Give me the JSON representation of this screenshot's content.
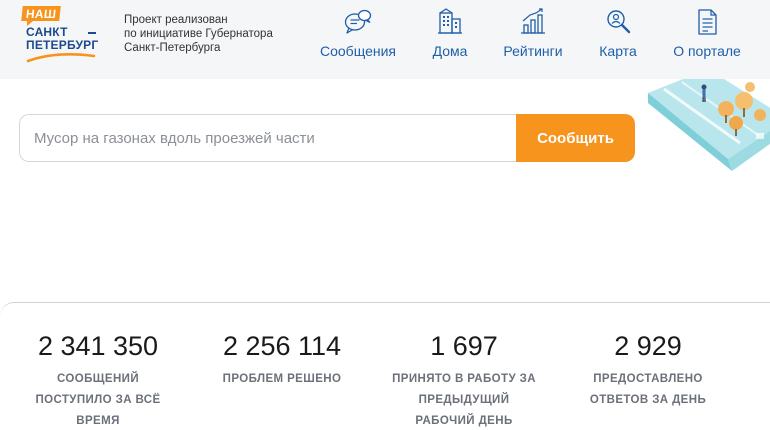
{
  "header": {
    "logo": {
      "line1": "НАШ",
      "line2": "САНКТ",
      "line3": "ПЕТЕРБУРГ"
    },
    "tagline": [
      "Проект реализован",
      "по инициативе Губернатора",
      "Санкт-Петербурга"
    ],
    "nav": [
      {
        "label": "Сообщения",
        "icon": "messages-icon"
      },
      {
        "label": "Дома",
        "icon": "buildings-icon"
      },
      {
        "label": "Рейтинги",
        "icon": "ratings-chart-icon"
      },
      {
        "label": "Карта",
        "icon": "map-search-icon"
      },
      {
        "label": "О портале",
        "icon": "document-icon"
      }
    ]
  },
  "search": {
    "placeholder": "Мусор на газонах вдоль проезжей части",
    "value": "",
    "button_label": "Сообщить"
  },
  "stats": [
    {
      "number": "2 341 350",
      "caption": [
        "СООБЩЕНИЙ",
        "ПОСТУПИЛО ЗА ВСЁ",
        "ВРЕМЯ"
      ]
    },
    {
      "number": "2 256 114",
      "caption": [
        "ПРОБЛЕМ РЕШЕНО"
      ]
    },
    {
      "number": "1 697",
      "caption": [
        "ПРИНЯТО В РАБОТУ ЗА",
        "ПРЕДЫДУЩИЙ",
        "РАБОЧИЙ ДЕНЬ"
      ]
    },
    {
      "number": "2 929",
      "caption": [
        "ПРЕДОСТАВЛЕНО",
        "ОТВЕТОВ ЗА ДЕНЬ"
      ]
    }
  ],
  "colors": {
    "accent": "#f7941d",
    "brand_blue": "#1d4a8c",
    "link_blue": "#1f5ea8"
  }
}
